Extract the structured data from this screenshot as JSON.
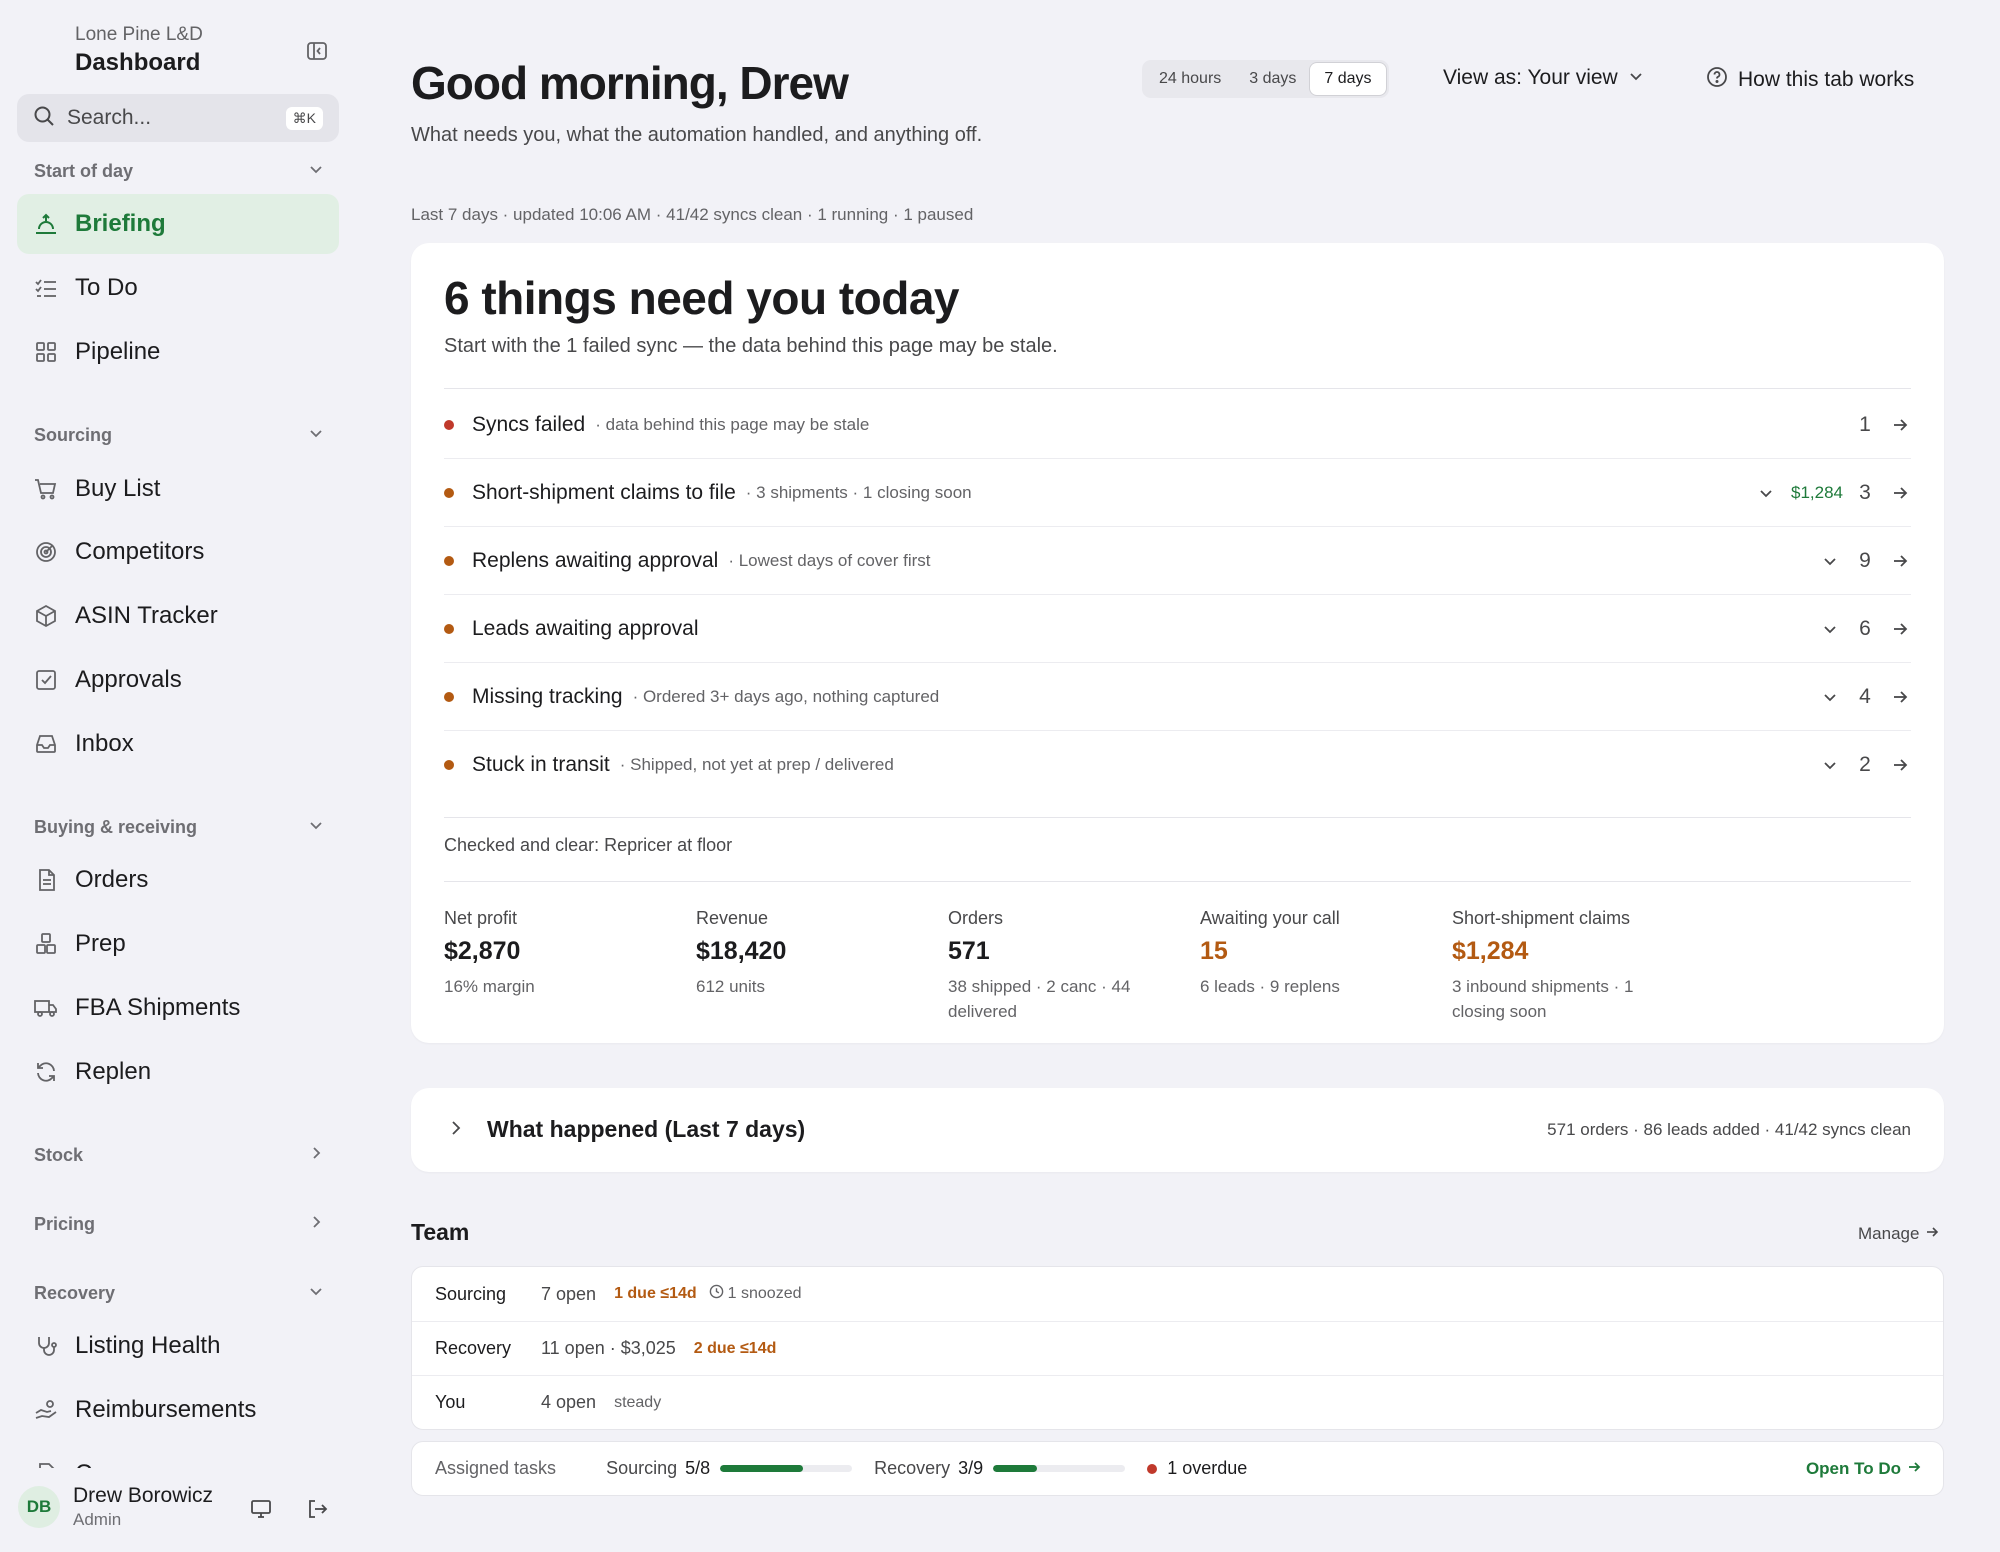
{
  "sidebar": {
    "org": "Lone Pine L&D",
    "title": "Dashboard",
    "search_placeholder": "Search...",
    "search_shortcut": "⌘K",
    "sections": {
      "start": "Start of day",
      "sourcing": "Sourcing",
      "buying": "Buying & receiving",
      "stock": "Stock",
      "pricing": "Pricing",
      "recovery": "Recovery"
    },
    "items": {
      "briefing": "Briefing",
      "todo": "To Do",
      "pipeline": "Pipeline",
      "buylist": "Buy List",
      "competitors": "Competitors",
      "asin": "ASIN Tracker",
      "approvals": "Approvals",
      "inbox": "Inbox",
      "orders": "Orders",
      "prep": "Prep",
      "fba": "FBA Shipments",
      "replen": "Replen",
      "listing_health": "Listing Health",
      "reimbursements": "Reimbursements",
      "cases": "Cases"
    },
    "user": {
      "initials": "DB",
      "name": "Drew Borowicz",
      "role": "Admin"
    }
  },
  "header": {
    "greeting": "Good morning, Drew",
    "subtitle": "What needs you, what the automation handled, and anything off.",
    "ranges": [
      "24 hours",
      "3 days",
      "7 days"
    ],
    "selected_range": "7 days",
    "view_as": "View as: Your view",
    "how_to": "How this tab works",
    "status_line": "Last 7 days · updated 10:06 AM · 41/42 syncs clean · 1 running · 1 paused"
  },
  "today": {
    "title": "6 things need you today",
    "subtitle": "Start with the 1 failed sync — the data behind this page may be stale.",
    "rows": [
      {
        "label": "Syncs failed",
        "meta": "· data behind this page may be stale",
        "amount": "",
        "count": "1",
        "dot": "#c0392b",
        "expand": false
      },
      {
        "label": "Short-shipment claims to file",
        "meta": "· 3 shipments · 1 closing soon",
        "amount": "$1,284",
        "count": "3",
        "dot": "#b35a12",
        "expand": true
      },
      {
        "label": "Replens awaiting approval",
        "meta": "· Lowest days of cover first",
        "amount": "",
        "count": "9",
        "dot": "#b35a12",
        "expand": true
      },
      {
        "label": "Leads awaiting approval",
        "meta": "",
        "amount": "",
        "count": "6",
        "dot": "#b35a12",
        "expand": true
      },
      {
        "label": "Missing tracking",
        "meta": "· Ordered 3+ days ago, nothing captured",
        "amount": "",
        "count": "4",
        "dot": "#b35a12",
        "expand": true
      },
      {
        "label": "Stuck in transit",
        "meta": "· Shipped, not yet at prep / delivered",
        "amount": "",
        "count": "2",
        "dot": "#b35a12",
        "expand": true
      }
    ],
    "clear_note": "Checked and clear: Repricer at floor",
    "metrics": {
      "net_profit": {
        "label": "Net profit",
        "value": "$2,870",
        "sub": "16% margin"
      },
      "revenue": {
        "label": "Revenue",
        "value": "$18,420",
        "sub": "612 units"
      },
      "orders": {
        "label": "Orders",
        "value": "571",
        "sub": "38 shipped · 2 canc · 44 delivered"
      },
      "awaiting": {
        "label": "Awaiting your call",
        "value": "15",
        "sub": "6 leads · 9 replens"
      },
      "claims": {
        "label": "Short-shipment claims",
        "value": "$1,284",
        "sub": "3 inbound shipments · 1 closing soon"
      }
    }
  },
  "happened": {
    "title": "What happened (Last 7 days)",
    "meta": "571 orders · 86 leads added · 41/42 syncs clean"
  },
  "team": {
    "title": "Team",
    "manage": "Manage",
    "rows": {
      "sourcing": {
        "name": "Sourcing",
        "open": "7 open",
        "due": "1 due ≤14d",
        "snoozed": "1 snoozed"
      },
      "recovery": {
        "name": "Recovery",
        "open": "11 open · $3,025",
        "due": "2 due ≤14d"
      },
      "you": {
        "name": "You",
        "open": "4 open",
        "status": "steady"
      }
    }
  },
  "tasks": {
    "label": "Assigned tasks",
    "sourcing": {
      "name": "Sourcing",
      "value": "5/8",
      "progress": 0.625
    },
    "recovery": {
      "name": "Recovery",
      "value": "3/9",
      "progress": 0.333
    },
    "overdue": "1 overdue",
    "open_todo": "Open To Do"
  },
  "colors": {
    "accent": "#1e7a3a",
    "warning": "#b35a12",
    "danger": "#c0392b"
  }
}
